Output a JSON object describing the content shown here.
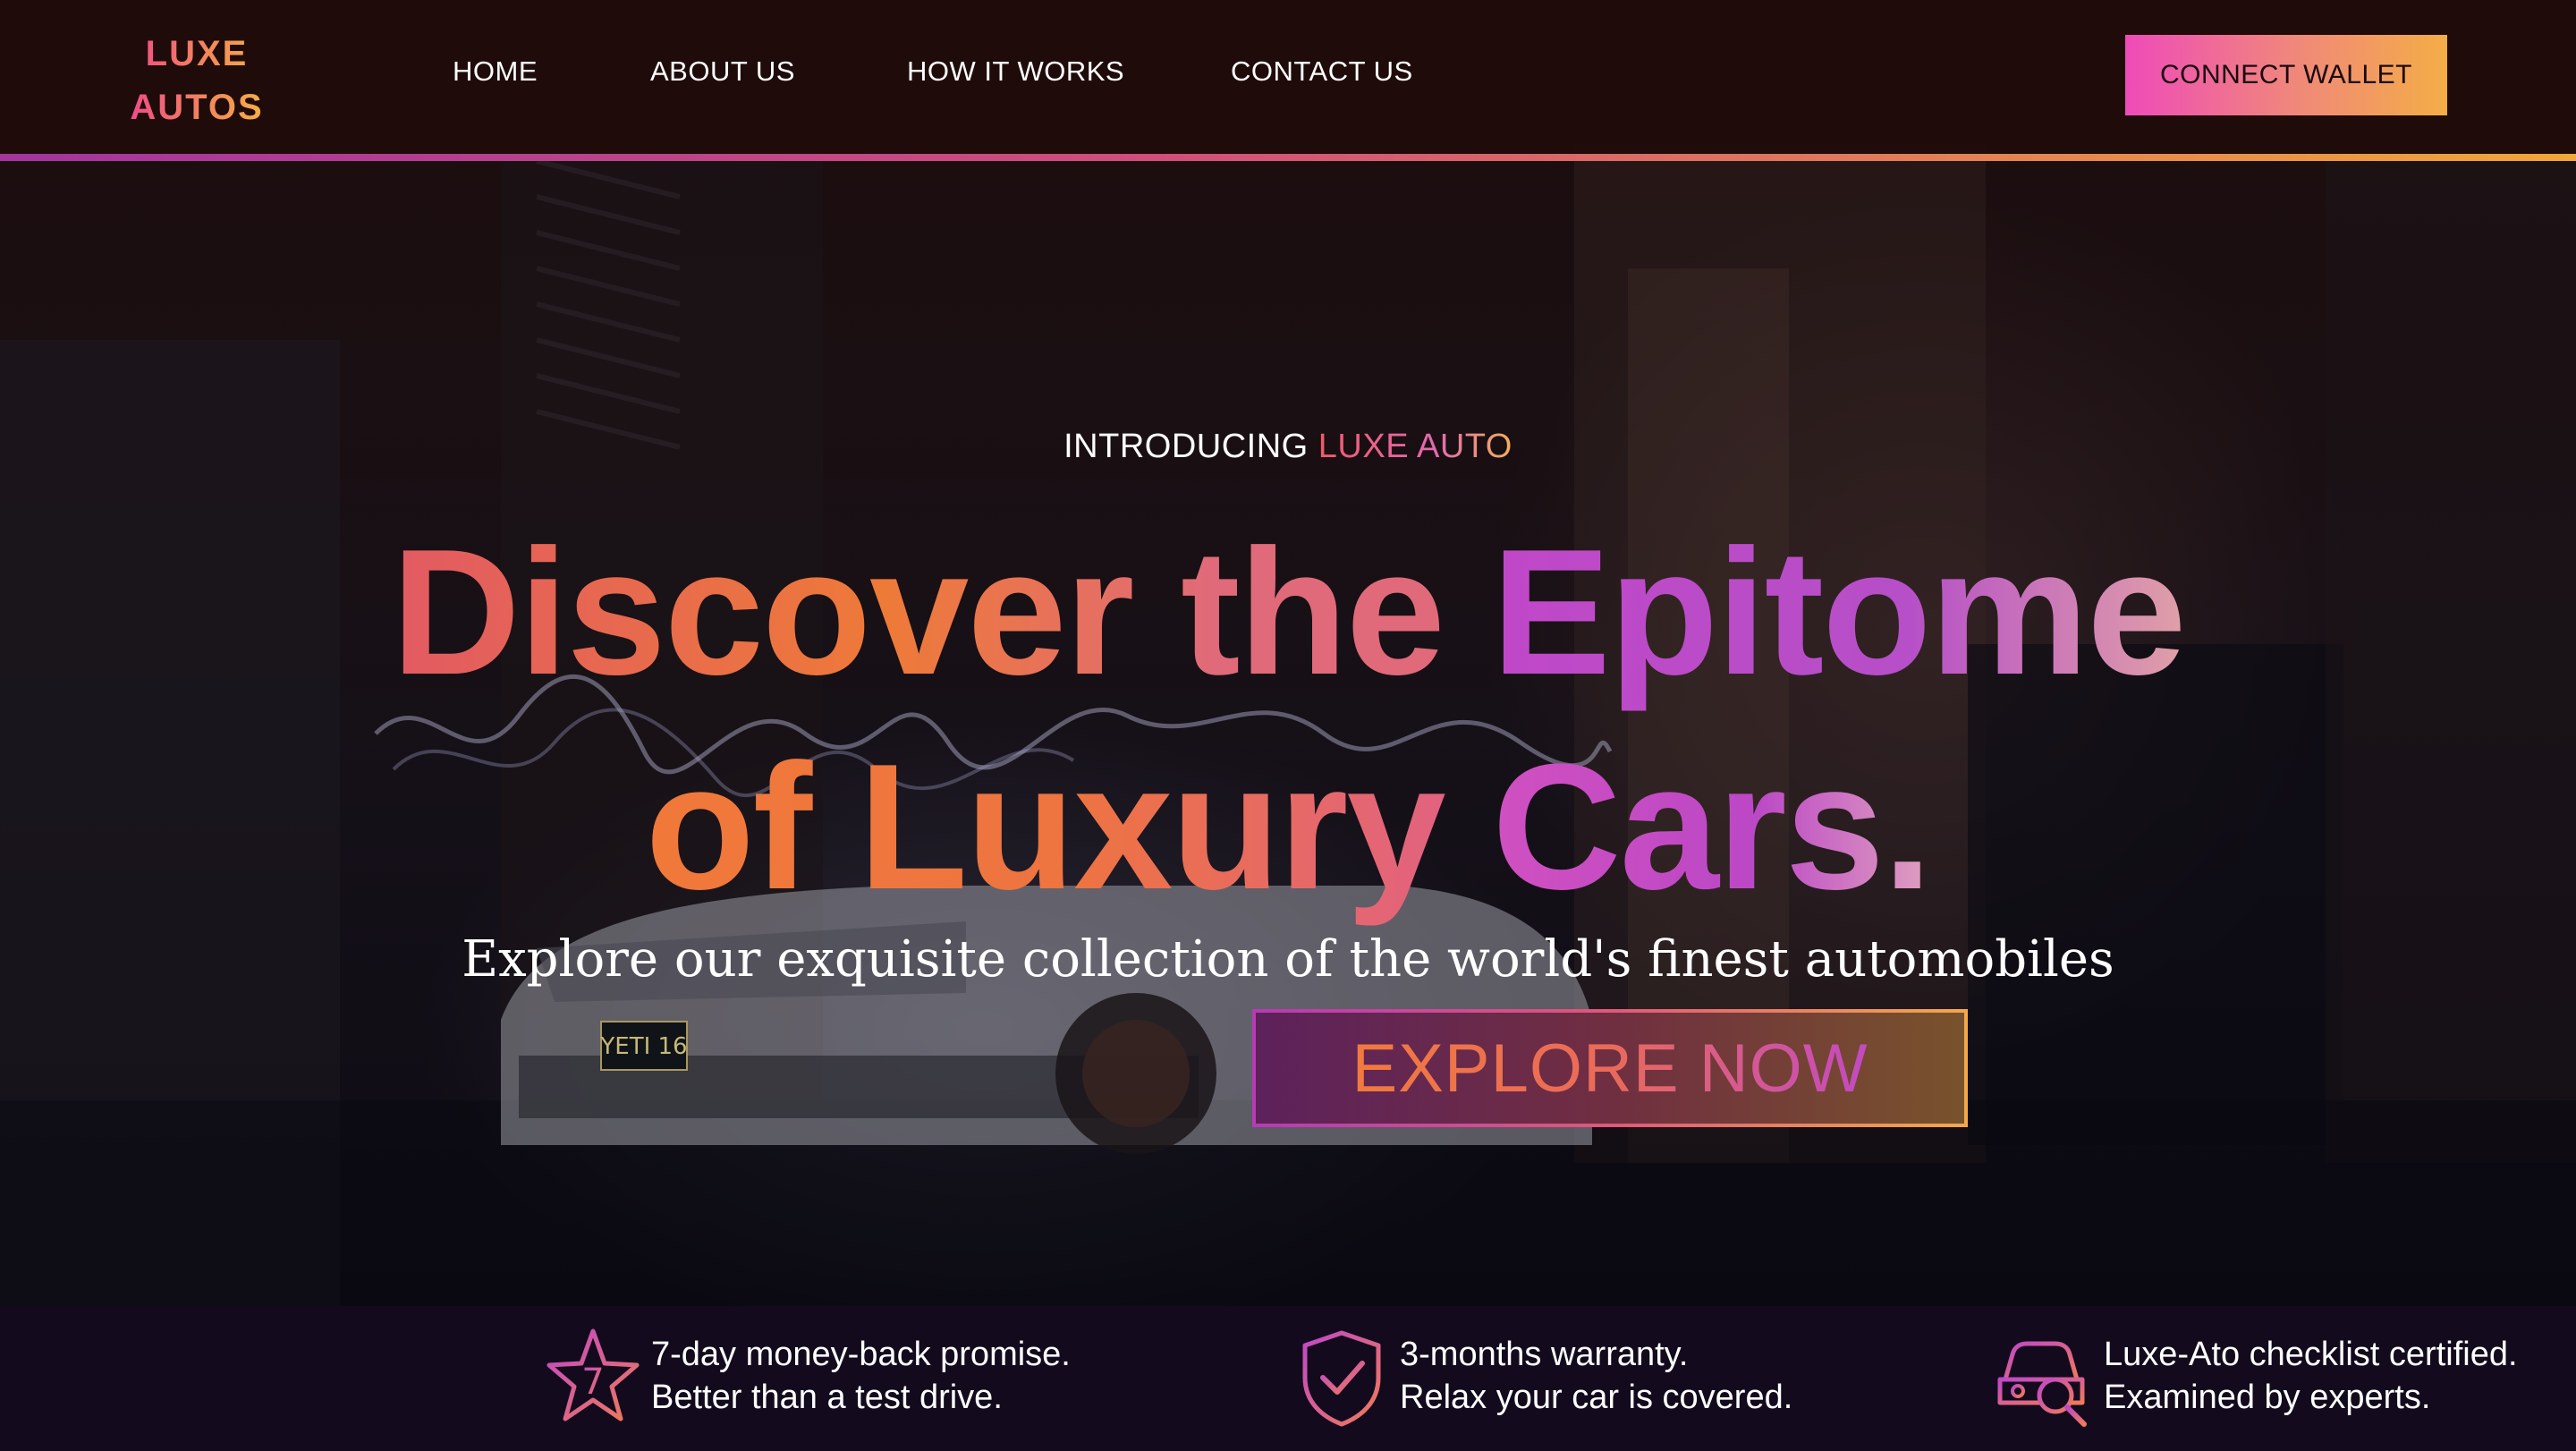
{
  "header": {
    "logo_line1": "LUXE",
    "logo_line2": "AUTOS",
    "nav": [
      {
        "label": "HOME"
      },
      {
        "label": "ABOUT US"
      },
      {
        "label": "HOW IT WORKS"
      },
      {
        "label": "CONTACT US"
      }
    ],
    "connect_wallet": "CONNECT WALLET"
  },
  "hero": {
    "intro_prefix": "INTRODUCING ",
    "intro_accent": "LUXE AUTO",
    "headline_1a": "Discover the ",
    "headline_1b": "Epitome",
    "headline_2a": "of Luxury ",
    "headline_2b": "Cars.",
    "subtitle": "Explore our exquisite collection of the world's finest automobiles",
    "cta": "EXPLORE NOW",
    "license_plate": "YETI 16"
  },
  "features": [
    {
      "icon": "star-seven-icon",
      "line1": "7-day money-back promise.",
      "line2": "Better than a test drive."
    },
    {
      "icon": "shield-check-icon",
      "line1": "3-months warranty.",
      "line2": "Relax your car is covered."
    },
    {
      "icon": "car-search-icon",
      "line1": "Luxe-Ato checklist certified.",
      "line2": "Examined by experts."
    }
  ],
  "colors": {
    "brand_pink": "#ef4bb9",
    "brand_orange": "#f4ad46",
    "header_bg": "#200c0a",
    "features_bg": "#130b1d"
  }
}
